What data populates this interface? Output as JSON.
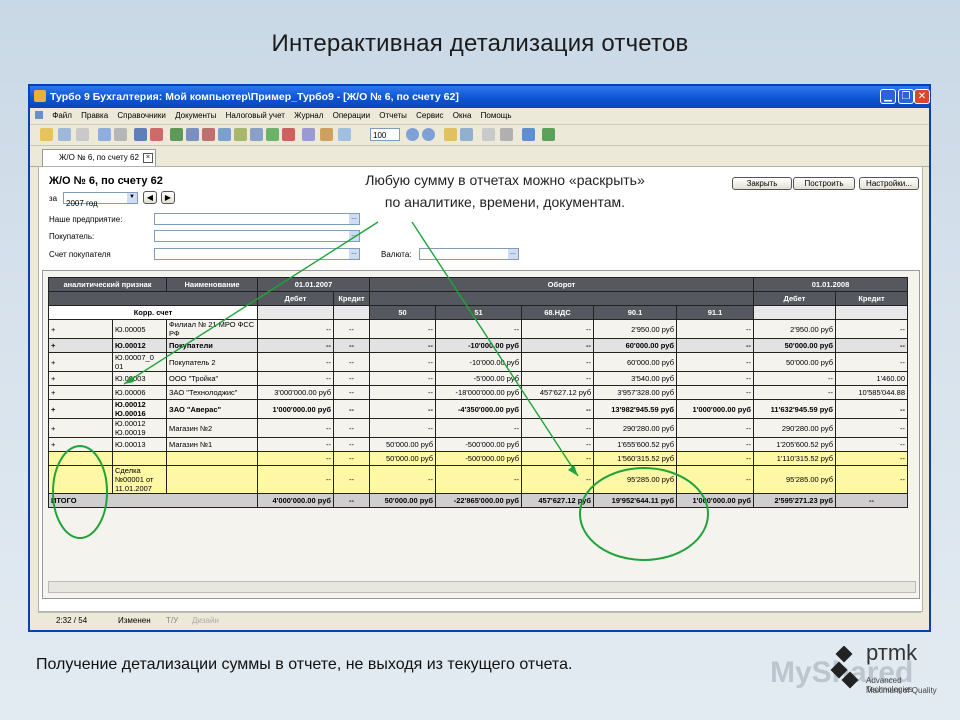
{
  "slide": {
    "title": "Интерактивная детализация отчетов",
    "caption": "Получение детализации суммы в отчете, не выходя из текущего отчета.",
    "brand_name": "ртmk",
    "brand_tag1": "Advanced Technologies",
    "brand_tag2": "Maximum of Quality",
    "watermark": "MyShared"
  },
  "window": {
    "title": "Турбо 9 Бухгалтерия: Мой компьютер\\Пример_Турбо9 - [Ж/О № 6, по счету 62]",
    "menu": [
      "Файл",
      "Правка",
      "Справочники",
      "Документы",
      "Налоговый учет",
      "Журнал",
      "Операции",
      "Отчеты",
      "Сервис",
      "Окна",
      "Помощь"
    ],
    "zoom": "100",
    "tab_label": "Ж/О № 6, по счету 62"
  },
  "form": {
    "title": "Ж/О № 6, по счету 62",
    "period_prefix": "за",
    "period_value": "2007 год",
    "our_company_label": "Наше предприятие:",
    "buyer_label": "Покупатель:",
    "invoice_label": "Счет покупателя",
    "currency_label": "Валюта:",
    "btn_close": "Закрыть",
    "btn_build": "Построить",
    "btn_settings": "Настройки...",
    "annotation_line1": "Любую сумму в отчетах можно «раскрыть»",
    "annotation_line2": "по аналитике, времени, документам."
  },
  "table": {
    "h_attr": "аналитический признак",
    "h_name": "Наименование",
    "h_date1": "01.01.2007",
    "h_turnover": "Оборот",
    "h_date2": "01.01.2008",
    "h_debit": "Дебет",
    "h_credit": "Кредит",
    "h_corr": "Корр. счет",
    "h_50": "50",
    "h_51": "51",
    "h_68": "68.НДС",
    "h_901": "90.1",
    "h_911": "91.1",
    "h_debit2": "Дебет",
    "h_credit2": "Кредит",
    "rows": [
      {
        "m": "+",
        "code": "Ю.00005",
        "name": "Филиал № 21 МРО ФСС РФ",
        "d1": "--",
        "c1": "--",
        "t50": "--",
        "t51": "--",
        "t68": "--",
        "t901": "2'950.00  руб",
        "t911": "--",
        "d2": "2'950.00  руб",
        "c2": "--"
      },
      {
        "m": "+",
        "code": "Ю.00012",
        "name": "Покупатели",
        "d1": "--",
        "c1": "--",
        "t50": "--",
        "t51": "-10'000.00  руб",
        "t68": "--",
        "t901": "60'000.00  руб",
        "t911": "--",
        "d2": "50'000.00  руб",
        "c2": "--"
      },
      {
        "m": "+",
        "code": "Ю.00007_0 01",
        "name": "Покупатель 2",
        "d1": "--",
        "c1": "--",
        "t50": "--",
        "t51": "-10'000.00  руб",
        "t68": "--",
        "t901": "60'000.00  руб",
        "t911": "--",
        "d2": "50'000.00  руб",
        "c2": "--"
      },
      {
        "m": "+",
        "code": "Ю.00003",
        "name": "ООО \"Тройка\"",
        "d1": "--",
        "c1": "--",
        "t50": "--",
        "t51": "-5'000.00  руб",
        "t68": "--",
        "t901": "3'540.00  руб",
        "t911": "--",
        "d2": "--",
        "c2": "1'460.00"
      },
      {
        "m": "+",
        "code": "Ю.00006",
        "name": "ЗАО \"Технолоджис\"",
        "d1": "3'000'000.00  руб",
        "c1": "--",
        "t50": "--",
        "t51": "-18'000'000.00  руб",
        "t68": "457'627.12  руб",
        "t901": "3'957'328.00  руб",
        "t911": "--",
        "d2": "--",
        "c2": "10'585'044.88"
      },
      {
        "m": "+",
        "code": "Ю.00012 Ю.00016",
        "name": "ЗАО \"Аверас\"",
        "d1": "1'000'000.00  руб",
        "c1": "--",
        "t50": "--",
        "t51": "-4'350'000.00  руб",
        "t68": "--",
        "t901": "13'982'945.59  руб",
        "t911": "1'000'000.00  руб",
        "d2": "11'632'945.59  руб",
        "c2": "--"
      },
      {
        "m": "+",
        "code": "Ю.00012 Ю.00019",
        "name": "Магазин №2",
        "d1": "--",
        "c1": "--",
        "t50": "--",
        "t51": "--",
        "t68": "--",
        "t901": "290'280.00  руб",
        "t911": "--",
        "d2": "290'280.00  руб",
        "c2": "--"
      },
      {
        "m": "+",
        "code": "Ю.00013",
        "name": "Магазин №1",
        "d1": "--",
        "c1": "--",
        "t50": "50'000.00  руб",
        "t51": "-500'000.00  руб",
        "t68": "--",
        "t901": "1'655'600.52  руб",
        "t911": "--",
        "d2": "1'205'600.52  руб",
        "c2": "--"
      },
      {
        "m": "",
        "code": "",
        "name": "",
        "d1": "--",
        "c1": "--",
        "t50": "50'000.00  руб",
        "t51": "-500'000.00  руб",
        "t68": "--",
        "t901": "1'560'315.52  руб",
        "t911": "--",
        "d2": "1'110'315.52  руб",
        "c2": "--"
      },
      {
        "m": "",
        "code": "Сделка №00001 от 11.01.2007",
        "name": "",
        "d1": "--",
        "c1": "--",
        "t50": "--",
        "t51": "--",
        "t68": "--",
        "t901": "95'285.00  руб",
        "t911": "--",
        "d2": "95'285.00  руб",
        "c2": "--"
      }
    ],
    "total": {
      "label": "ИТОГО",
      "d1": "4'000'000.00  руб",
      "c1": "--",
      "t50": "50'000.00  руб",
      "t51": "-22'865'000.00  руб",
      "t68": "457'627.12  руб",
      "t901": "19'952'644.11  руб",
      "t911": "1'000'000.00  руб",
      "d2": "2'595'271.23  руб",
      "c2": "--"
    }
  },
  "statusbar": {
    "pos": "2:32 / 54",
    "state": "Изменен",
    "a": "Т/У",
    "b": "Дизайн"
  },
  "colors": {
    "accent_green": "#1fa33a",
    "header_gray": "#55595f",
    "highlight_yellow": "#fdf7a6"
  }
}
